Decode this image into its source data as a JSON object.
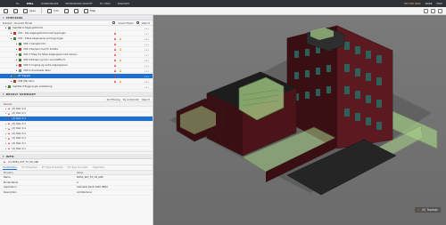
{
  "topbar": {
    "tabs": [
      "FIL",
      "SPILL",
      "COMMUNICATE",
      "INFORMATION TAKEOFF",
      "FLY VIEW",
      "WINDOWS"
    ],
    "active_index": 1,
    "right": [
      "TRY FOR 30DS",
      "MORE",
      "HELP"
    ]
  },
  "toolbar": {
    "items": [
      "Spec",
      "Info",
      "Map"
    ]
  },
  "checking": {
    "title": "CHECKING",
    "ruleset": "Ruleset - Checked Model",
    "check_model_label": "Check Model",
    "report_label": "Report",
    "rows": [
      {
        "label": "Kapittel 6 Adgangsforhold",
        "indent": 1,
        "selected": false
      },
      {
        "label": "001 - Alle adgangsforhold ved bygningen",
        "indent": 2,
        "selected": false
      },
      {
        "label": "001 - Felles adgangsvei ved bygningen",
        "indent": 2,
        "selected": false
      },
      {
        "label": "005-1 Gangkorridor",
        "indent": 3,
        "selected": false
      },
      {
        "label": "005-2 Ramper med fri bredde",
        "indent": 3,
        "selected": false
      },
      {
        "label": "005-3 Trapp fra felles adgangsvei med hensyn",
        "indent": 3,
        "selected": false
      },
      {
        "label": "005-4 Rampe og trinn ved plattform",
        "indent": 3,
        "selected": false
      },
      {
        "label": "005-5 Inngang og andre adgangssone",
        "indent": 3,
        "selected": false
      },
      {
        "label": "005-6 Universelle dører",
        "indent": 3,
        "selected": false
      },
      {
        "label": "07 Trapper",
        "indent": 2,
        "selected": true
      },
      {
        "label": "008 (84) Vann",
        "indent": 2,
        "selected": false
      },
      {
        "label": "Kapittel 8 Byggningen installering",
        "indent": 1,
        "selected": false
      }
    ]
  },
  "result_summary": {
    "title": "RESULT SUMMARY",
    "filter": "No Filtering",
    "sort": "By Automatic",
    "report_label": "Report",
    "column": "Results",
    "rows": [
      {
        "label": "(X) Stair 2.0",
        "selected": false
      },
      {
        "label": "(X) Stair 0.1",
        "selected": false
      },
      {
        "label": "(X) Stair 0.1",
        "selected": true
      },
      {
        "label": "(X) Stair 0.1",
        "selected": false
      },
      {
        "label": "(X) Stair 0.1",
        "selected": false
      },
      {
        "label": "(X) Stair 0.1",
        "selected": false
      },
      {
        "label": "(X) Stair 0.1",
        "selected": false
      },
      {
        "label": "(X) Stair 0.1",
        "selected": false
      },
      {
        "label": "(X) Stair 0.1",
        "selected": false
      }
    ]
  },
  "info": {
    "title": "INFO",
    "object": "(X) NO5A_K07_F2_H0_ARK",
    "tabs": [
      "Identification",
      "IFC Properties",
      "IFC Type Properties",
      "IFC Type Concepts",
      "Hyperlinks"
    ],
    "active_tab": 0,
    "columns": [
      "Property",
      "Value"
    ],
    "rows": [
      {
        "k": "Name",
        "v": "NO5A_K07_F2_H0_ARK"
      },
      {
        "k": "Model Name",
        "v": "A"
      },
      {
        "k": "Application",
        "v": "Autodesk Revit 2020 (ENU)"
      },
      {
        "k": "Description",
        "v": "Architectural"
      }
    ]
  },
  "viewport": {
    "badge": "(X) Toptegn"
  },
  "colors": {
    "accent": "#1e6fd0",
    "error": "#e03a2f",
    "warning": "#f2a21e",
    "facade": "#4a1418",
    "glass": "#a9d28a"
  }
}
